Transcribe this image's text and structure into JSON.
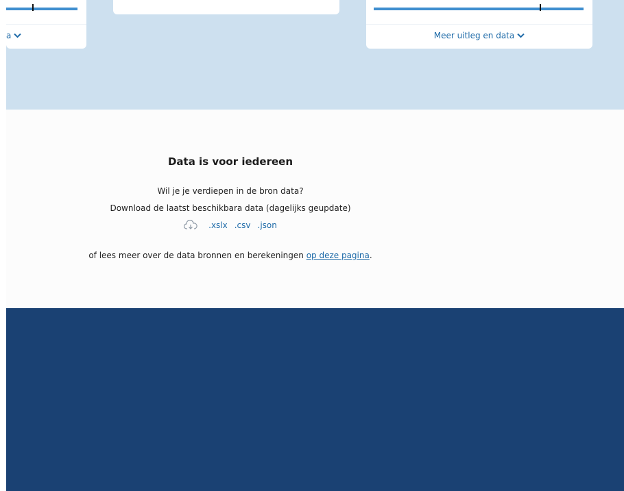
{
  "cards": {
    "left": {
      "more_label": "a",
      "progress_fraction": 0.37
    },
    "right": {
      "more_label": "Meer uitleg en data",
      "progress_fraction": 0.79
    }
  },
  "data_section": {
    "title": "Data is voor iedereen",
    "line1": "Wil je je verdiepen in de bron data?",
    "line2": "Download de laatst beschikbara data (dagelijks geupdate)",
    "downloads": [
      ".xslx",
      ".csv",
      ".json"
    ],
    "outro_prefix": "of lees meer over de data bronnen en berekeningen ",
    "outro_link": "op deze pagina",
    "outro_suffix": "."
  },
  "colors": {
    "accent": "#1d6aa8",
    "top_band": "#cde0ef",
    "footer": "#1a4173",
    "bar": "#3f8ecf"
  },
  "icons": [
    "chevron-down-icon",
    "cloud-download-icon"
  ]
}
